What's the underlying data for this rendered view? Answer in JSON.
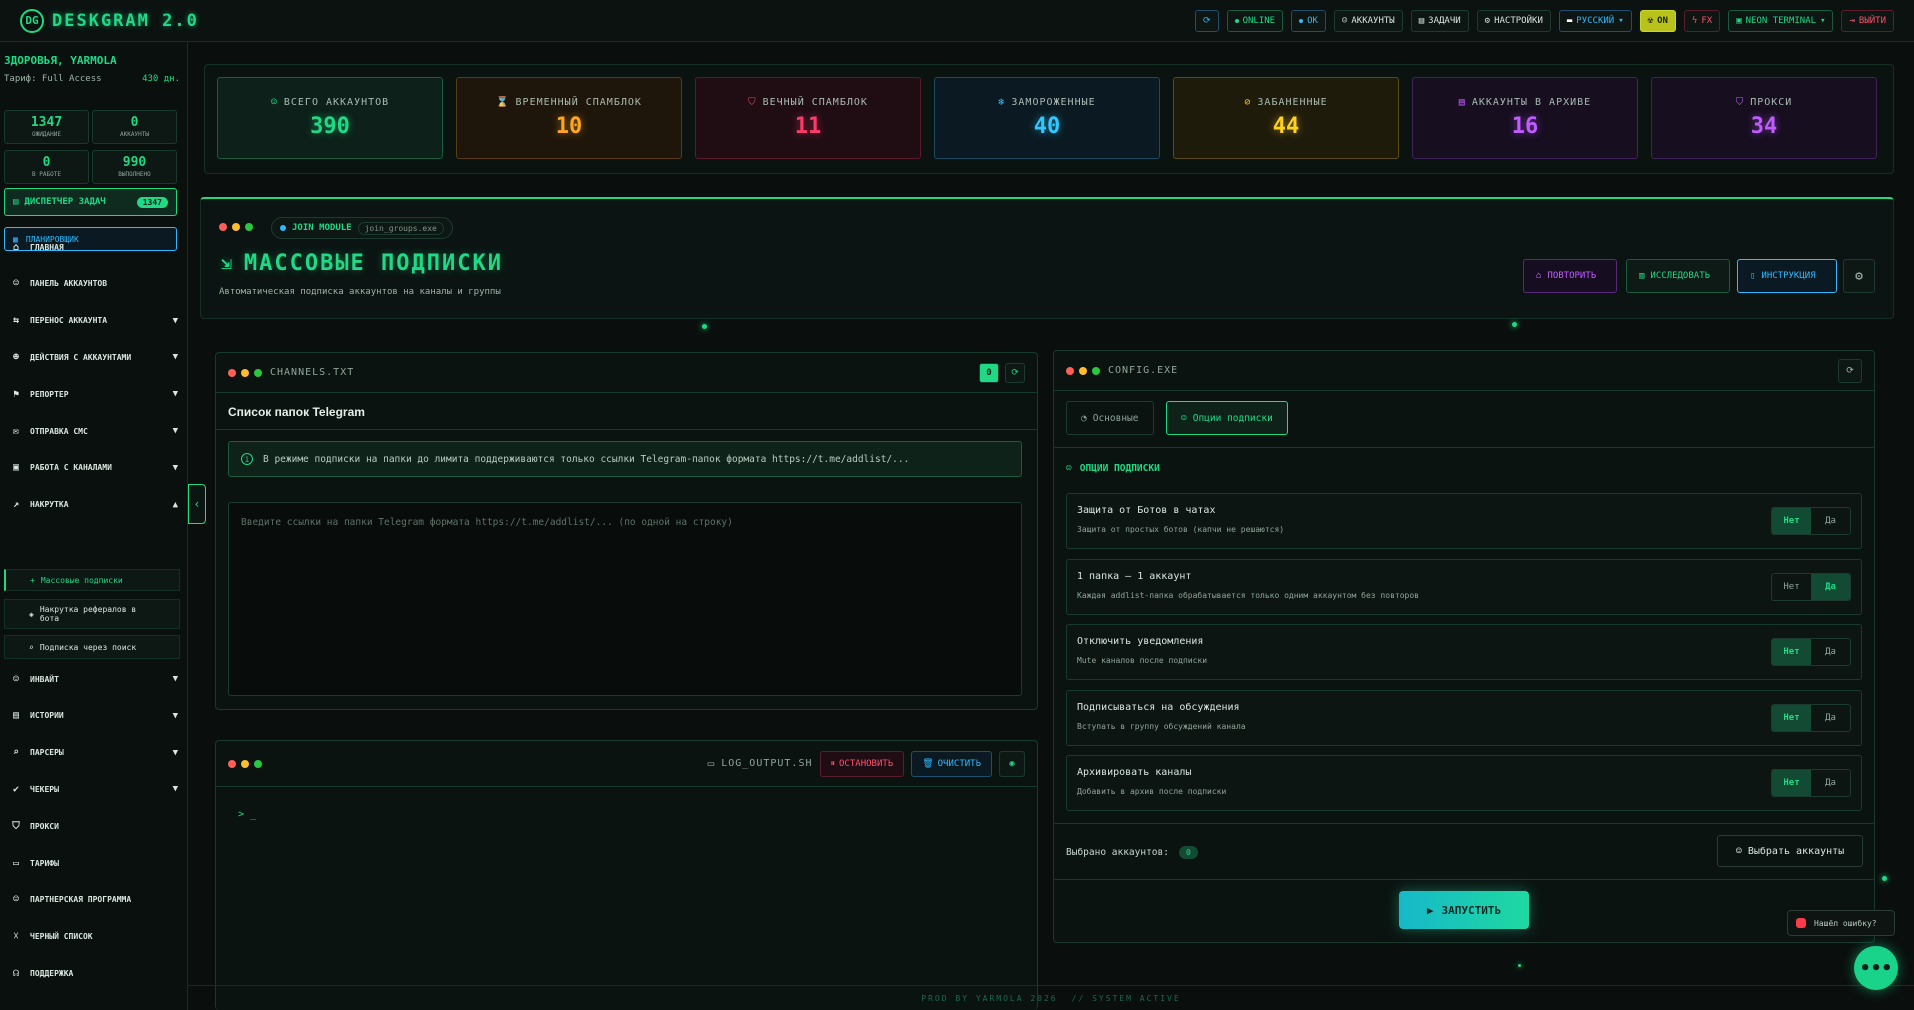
{
  "app": {
    "title": "DESKGRAM 2.0",
    "logo_glyph": "DG"
  },
  "topbar": {
    "refresh_icon": "refresh-icon",
    "online": "ONLINE",
    "ok": "OK",
    "accounts": "АККАУНТЫ",
    "tasks": "ЗАДАЧИ",
    "settings": "НАСТРОЙКИ",
    "language": "РУССКИЙ",
    "fx_on": "ON",
    "fx": "FX",
    "theme": "NEON TERMINAL",
    "logout": "ВЫЙТИ"
  },
  "sidebar": {
    "greeting": "ЗДОРОВЬЯ, YARMOLA",
    "tariff_label": "Тариф: Full Access",
    "days_left": "430 дн.",
    "stats": [
      {
        "value": "1347",
        "label": "ожидание"
      },
      {
        "value": "0",
        "label": "аккаунты"
      },
      {
        "value": "0",
        "label": "в работе"
      },
      {
        "value": "990",
        "label": "выполнено"
      }
    ],
    "task_manager": "ДИСПЕТЧЕР ЗАДАЧ",
    "task_manager_badge": "1347",
    "planner": "ПЛАНИРОВЩИК",
    "items": [
      {
        "label": "ГЛАВНАЯ",
        "icon": "home-icon",
        "glyph": "⌂",
        "chevron": ""
      },
      {
        "label": "ПАНЕЛЬ АККАУНТОВ",
        "icon": "users-icon",
        "glyph": "☺",
        "chevron": ""
      },
      {
        "label": "ПЕРЕНОС АККАУНТА",
        "icon": "transfer-icon",
        "glyph": "⇆",
        "chevron": "▼"
      },
      {
        "label": "ДЕЙСТВИЯ С АККАУНТАМИ",
        "icon": "user-cog-icon",
        "glyph": "☻",
        "chevron": "▼"
      },
      {
        "label": "РЕПОРТЕР",
        "icon": "flag-icon",
        "glyph": "⚑",
        "chevron": "▼"
      },
      {
        "label": "ОТПРАВКА СМС",
        "icon": "message-icon",
        "glyph": "✉",
        "chevron": "▼"
      },
      {
        "label": "РАБОТА С КАНАЛАМИ",
        "icon": "briefcase-icon",
        "glyph": "▣",
        "chevron": "▼"
      },
      {
        "label": "НАКРУТКА",
        "icon": "trending-icon",
        "glyph": "↗",
        "chevron": "▲"
      }
    ],
    "subitems": [
      {
        "label": "Массовые подписки",
        "icon": "user-plus-icon",
        "glyph": "+"
      },
      {
        "label": "Накрутка рефералов в бота",
        "icon": "referral-icon",
        "glyph": "◈"
      },
      {
        "label": "Подписка через поиск",
        "icon": "search-icon",
        "glyph": "⌕"
      }
    ],
    "items2": [
      {
        "label": "ИНВАЙТ",
        "icon": "invite-icon",
        "glyph": "☺",
        "chevron": "▼"
      },
      {
        "label": "ИСТОРИИ",
        "icon": "stories-icon",
        "glyph": "▤",
        "chevron": "▼"
      },
      {
        "label": "ПАРСЕРЫ",
        "icon": "search-icon",
        "glyph": "⌕",
        "chevron": "▼"
      },
      {
        "label": "ЧЕКЕРЫ",
        "icon": "check-icon",
        "glyph": "✔",
        "chevron": "▼"
      },
      {
        "label": "ПРОКСИ",
        "icon": "shield-icon",
        "glyph": "⛉",
        "chevron": ""
      },
      {
        "label": "ТАРИФЫ",
        "icon": "card-icon",
        "glyph": "▭",
        "chevron": ""
      },
      {
        "label": "ПАРТНЕРСКАЯ ПРОГРАММА",
        "icon": "partners-icon",
        "glyph": "☺",
        "chevron": ""
      },
      {
        "label": "ЧЕРНЫЙ СПИСОК",
        "icon": "user-x-icon",
        "glyph": "☓",
        "chevron": ""
      },
      {
        "label": "ПОДДЕРЖКА",
        "icon": "headset-icon",
        "glyph": "☊",
        "chevron": ""
      }
    ]
  },
  "stats": [
    {
      "label": "ВСЕГО АККАУНТОВ",
      "value": "390",
      "icon": "users-icon",
      "glyph": "☺",
      "color": "#1fd985",
      "bg": "#0d2019",
      "border": "#1a5a3e"
    },
    {
      "label": "ВРЕМЕННЫЙ СПАМБЛОК",
      "value": "10",
      "icon": "hourglass-icon",
      "glyph": "⌛",
      "color": "#ffa51f",
      "bg": "#1f160b",
      "border": "#5a3a12"
    },
    {
      "label": "ВЕЧНЫЙ СПАМБЛОК",
      "value": "11",
      "icon": "shield-alert-icon",
      "glyph": "⛉",
      "color": "#ff3b6a",
      "bg": "#200d14",
      "border": "#5a1a2a"
    },
    {
      "label": "ЗАМОРОЖЕННЫЕ",
      "value": "40",
      "icon": "snowflake-icon",
      "glyph": "❄",
      "color": "#2fc8ff",
      "bg": "#0b1a22",
      "border": "#1a4a60"
    },
    {
      "label": "ЗАБАНЕННЫЕ",
      "value": "44",
      "icon": "ban-icon",
      "glyph": "⊘",
      "color": "#ffd21f",
      "bg": "#1f1b0b",
      "border": "#5a4a12"
    },
    {
      "label": "АККАУНТЫ В АРХИВЕ",
      "value": "16",
      "icon": "archive-icon",
      "glyph": "▤",
      "color": "#c05cff",
      "bg": "#170e20",
      "border": "#3e2258"
    },
    {
      "label": "ПРОКСИ",
      "value": "34",
      "icon": "shield-icon",
      "glyph": "⛉",
      "color": "#c05cff",
      "bg": "#170e20",
      "border": "#3e2258"
    }
  ],
  "module": {
    "pill_label": "JOIN MODULE",
    "pill_sub": "join_groups.exe",
    "title": "МАССОВЫЕ ПОДПИСКИ",
    "subtitle": "Автоматическая подписка аккаунтов на каналы и группы",
    "repeat": "ПОВТОРИТЬ",
    "explore": "ИССЛЕДОВАТЬ",
    "instructions": "ИНСТРУКЦИЯ"
  },
  "channels": {
    "filename": "CHANNELS.TXT",
    "heading": "Список папок Telegram",
    "info": "В режиме подписки на папки до лимита поддерживаются только ссылки Telegram-папок формата https://t.me/addlist/...",
    "placeholder": "Введите ссылки на папки Telegram формата https://t.me/addlist/... (по одной на строку)",
    "count": "0"
  },
  "log": {
    "filename": "LOG_OUTPUT.SH",
    "stop": "ОСТАНОВИТЬ",
    "clear": "ОЧИСТИТЬ",
    "prompt": "> _"
  },
  "config": {
    "filename": "CONFIG.EXE",
    "tab_basic": "Основные",
    "tab_options": "Опции подписки",
    "section": "ОПЦИИ ПОДПИСКИ",
    "no": "Нет",
    "yes": "Да",
    "options": [
      {
        "title": "Защита от Ботов в чатах",
        "desc": "Защита от простых ботов (капчи не решаются)",
        "value": "Нет"
      },
      {
        "title": "1 папка — 1 аккаунт",
        "desc": "Каждая addlist-папка обрабатывается только одним аккаунтом без повторов",
        "value": "Да"
      },
      {
        "title": "Отключить уведомления",
        "desc": "Mute каналов после подписки",
        "value": "Нет"
      },
      {
        "title": "Подписываться на обсуждения",
        "desc": "Вступать в группу обсуждений канала",
        "value": "Нет"
      },
      {
        "title": "Архивировать каналы",
        "desc": "Добавить в архив после подписки",
        "value": "Нет"
      }
    ],
    "selected_label": "Выбрано аккаунтов:",
    "selected_count": "0",
    "choose_accounts": "Выбрать аккаунты",
    "launch": "ЗАПУСТИТЬ"
  },
  "footer": {
    "credit": "PROD BY YARMOLA 2026",
    "status": "// SYSTEM ACTIVE"
  },
  "report_error": "Нашёл ошибку?"
}
